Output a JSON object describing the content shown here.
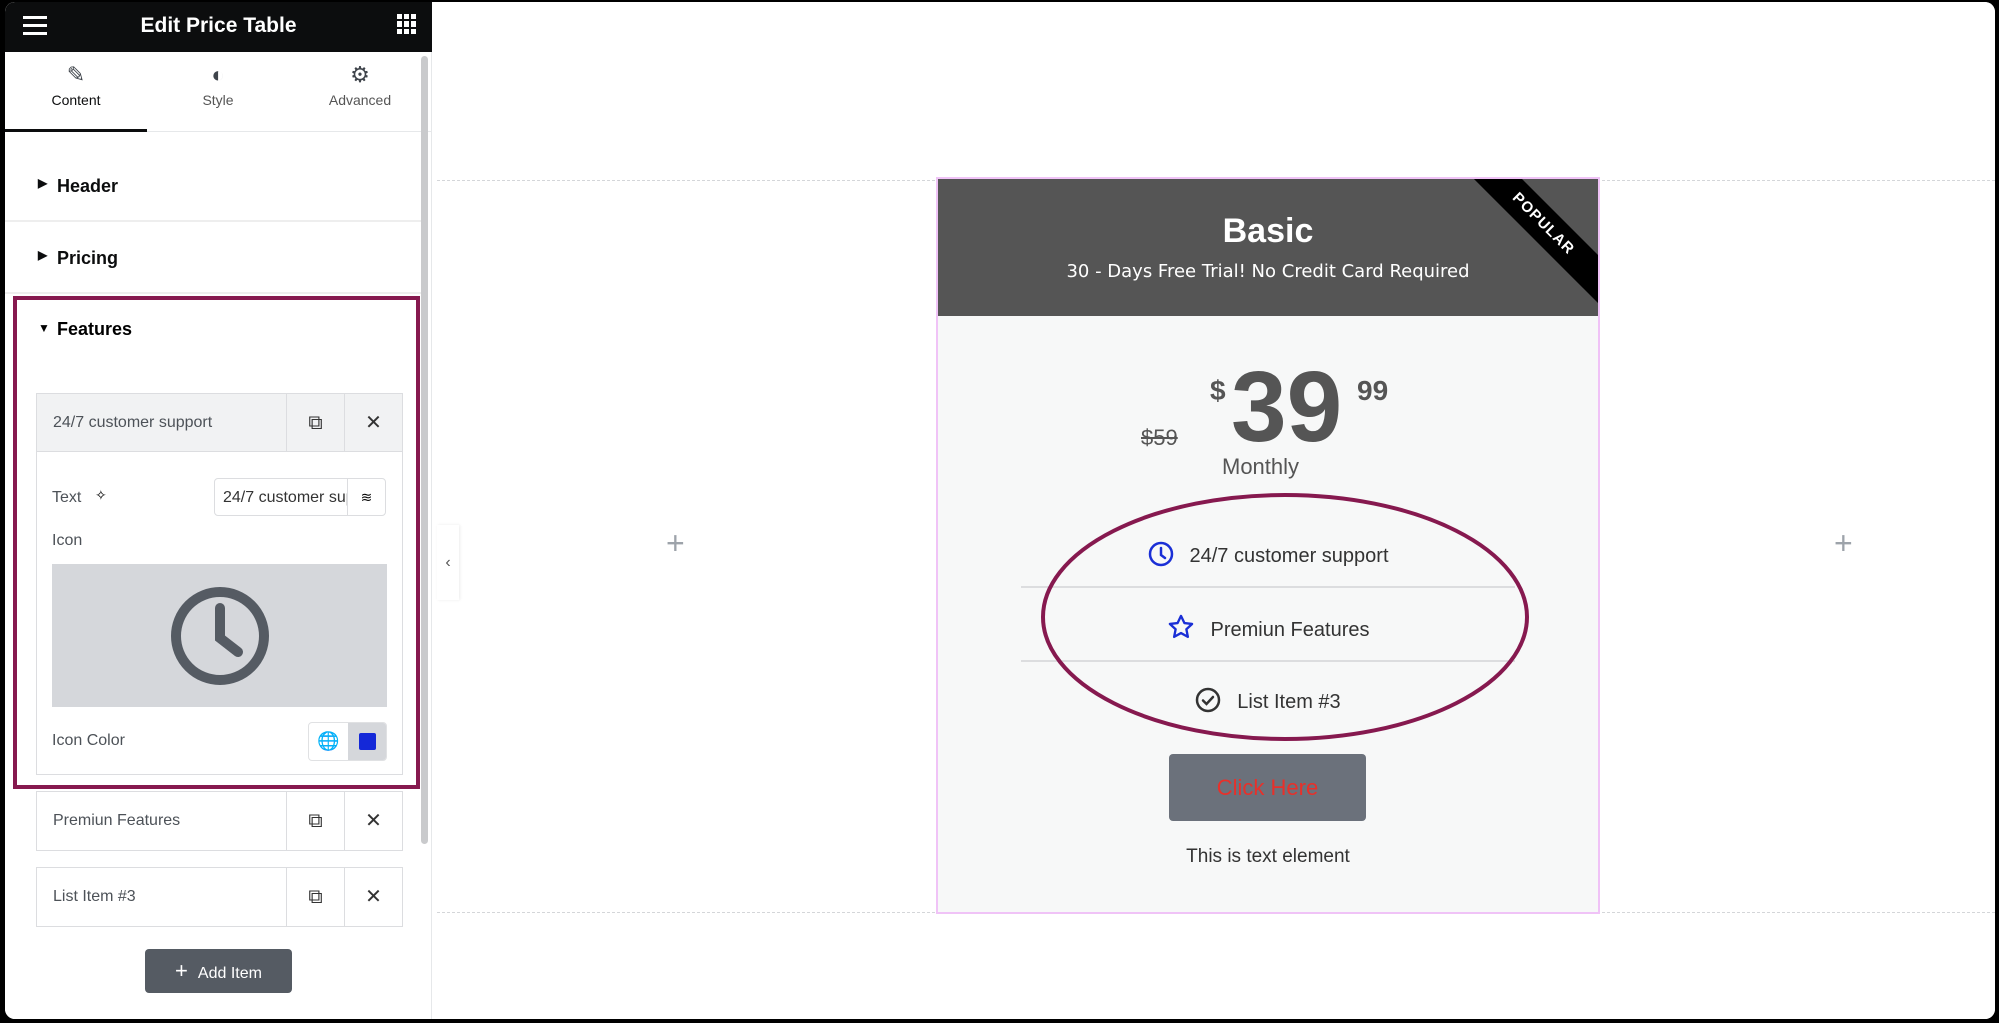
{
  "sidebar": {
    "title": "Edit Price Table",
    "tabs": [
      {
        "label": "Content",
        "icon": "pencil-icon"
      },
      {
        "label": "Style",
        "icon": "half-circle-icon"
      },
      {
        "label": "Advanced",
        "icon": "gear-icon"
      }
    ],
    "sections": [
      {
        "label": "Header"
      },
      {
        "label": "Pricing"
      },
      {
        "label": "Features"
      }
    ],
    "features": {
      "items": [
        {
          "label": "24/7 customer support"
        },
        {
          "label": "Premiun Features"
        },
        {
          "label": "List Item #3"
        }
      ],
      "text_label": "Text",
      "text_value": "24/7 customer support",
      "icon_label": "Icon",
      "icon_color_label": "Icon Color",
      "icon_color": "#1428d8",
      "add_item": "Add Item"
    }
  },
  "card": {
    "title": "Basic",
    "subtitle": "30 - Days Free Trial! No Credit Card Required",
    "ribbon": "POPULAR",
    "original_price": "$59",
    "currency": "$",
    "price": "39",
    "fraction": "99",
    "period": "Monthly",
    "features": [
      {
        "text": "24/7 customer support",
        "icon": "clock-icon",
        "color": "#1a2fd6"
      },
      {
        "text": "Premiun Features",
        "icon": "star-icon",
        "color": "#1a2fd6"
      },
      {
        "text": "List Item #3",
        "icon": "check-circle-icon",
        "color": "#333333"
      }
    ],
    "button": "Click Here",
    "footer_text": "This is text element"
  },
  "colors": {
    "highlight": "#86194f",
    "button_bg": "#6b717b",
    "button_text": "#e8302a"
  }
}
